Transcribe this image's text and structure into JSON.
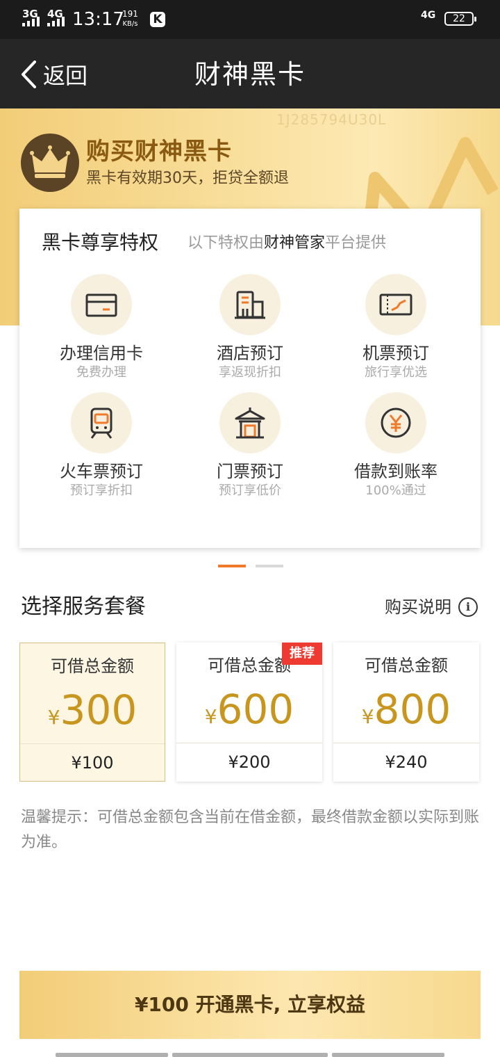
{
  "status_bar": {
    "sim1": "3G",
    "sim2": "4G",
    "time": "13:17",
    "speed_value": "191",
    "speed_unit": "KB/s",
    "app_badge": "K",
    "network": "4G",
    "battery": "22"
  },
  "nav": {
    "back_label": "返回",
    "title": "财神黑卡"
  },
  "banner": {
    "serial": "1J285794U30L",
    "title": "购买财神黑卡",
    "subtitle": "黑卡有效期30天，拒贷全额退"
  },
  "privileges": {
    "title": "黑卡尊享特权",
    "note_prefix": "以下特权由",
    "note_highlight": "财神管家",
    "note_suffix": "平台提供",
    "items": [
      {
        "label": "办理信用卡",
        "sub": "免费办理",
        "icon": "credit-card-icon"
      },
      {
        "label": "酒店预订",
        "sub": "享返现折扣",
        "icon": "hotel-icon"
      },
      {
        "label": "机票预订",
        "sub": "旅行享优选",
        "icon": "ticket-icon"
      },
      {
        "label": "火车票预订",
        "sub": "预订享折扣",
        "icon": "train-icon"
      },
      {
        "label": "门票预订",
        "sub": "预订享低价",
        "icon": "pavilion-icon"
      },
      {
        "label": "借款到账率",
        "sub": "100%通过",
        "icon": "yen-coin-icon"
      }
    ]
  },
  "packages": {
    "section_title": "选择服务套餐",
    "buy_desc": "购买说明",
    "info_glyph": "i",
    "currency": "¥",
    "recommend_badge": "推荐",
    "items": [
      {
        "label": "可借总金额",
        "amount": "300",
        "price": "¥100",
        "selected": true
      },
      {
        "label": "可借总金额",
        "amount": "600",
        "price": "¥200",
        "selected": false,
        "recommended": true
      },
      {
        "label": "可借总金额",
        "amount": "800",
        "price": "¥240",
        "selected": false
      }
    ]
  },
  "tip": "温馨提示：可借总金额包含当前在借金额，最终借款金额以实际到账为准。",
  "cta_label": "¥100 开通黑卡, 立享权益",
  "colors": {
    "gold": "#c8961e",
    "accent": "#f07a2a",
    "badge_red": "#ee3b32",
    "dark_bar": "#262626"
  }
}
